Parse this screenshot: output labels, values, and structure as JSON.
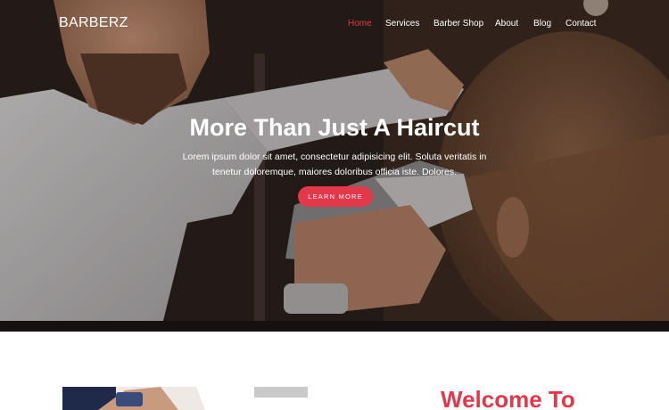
{
  "brand": "BARBERZ",
  "nav": {
    "items": [
      {
        "label": "Home",
        "active": true
      },
      {
        "label": "Services",
        "active": false
      },
      {
        "label": "Barber Shop",
        "active": false
      },
      {
        "label": "About",
        "active": false
      },
      {
        "label": "Blog",
        "active": false
      },
      {
        "label": "Contact",
        "active": false
      }
    ]
  },
  "hero": {
    "title": "More Than Just A Haircut",
    "subtitle": "Lorem ipsum dolor sit amet, consectetur adipisicing elit. Soluta veritatis in tenetur doloremque, maiores doloribus officia iste. Dolores.",
    "cta_label": "LEARN MORE"
  },
  "welcome": {
    "heading": "Welcome To"
  },
  "colors": {
    "accent": "#e3374a",
    "text_light": "#ffffff"
  }
}
